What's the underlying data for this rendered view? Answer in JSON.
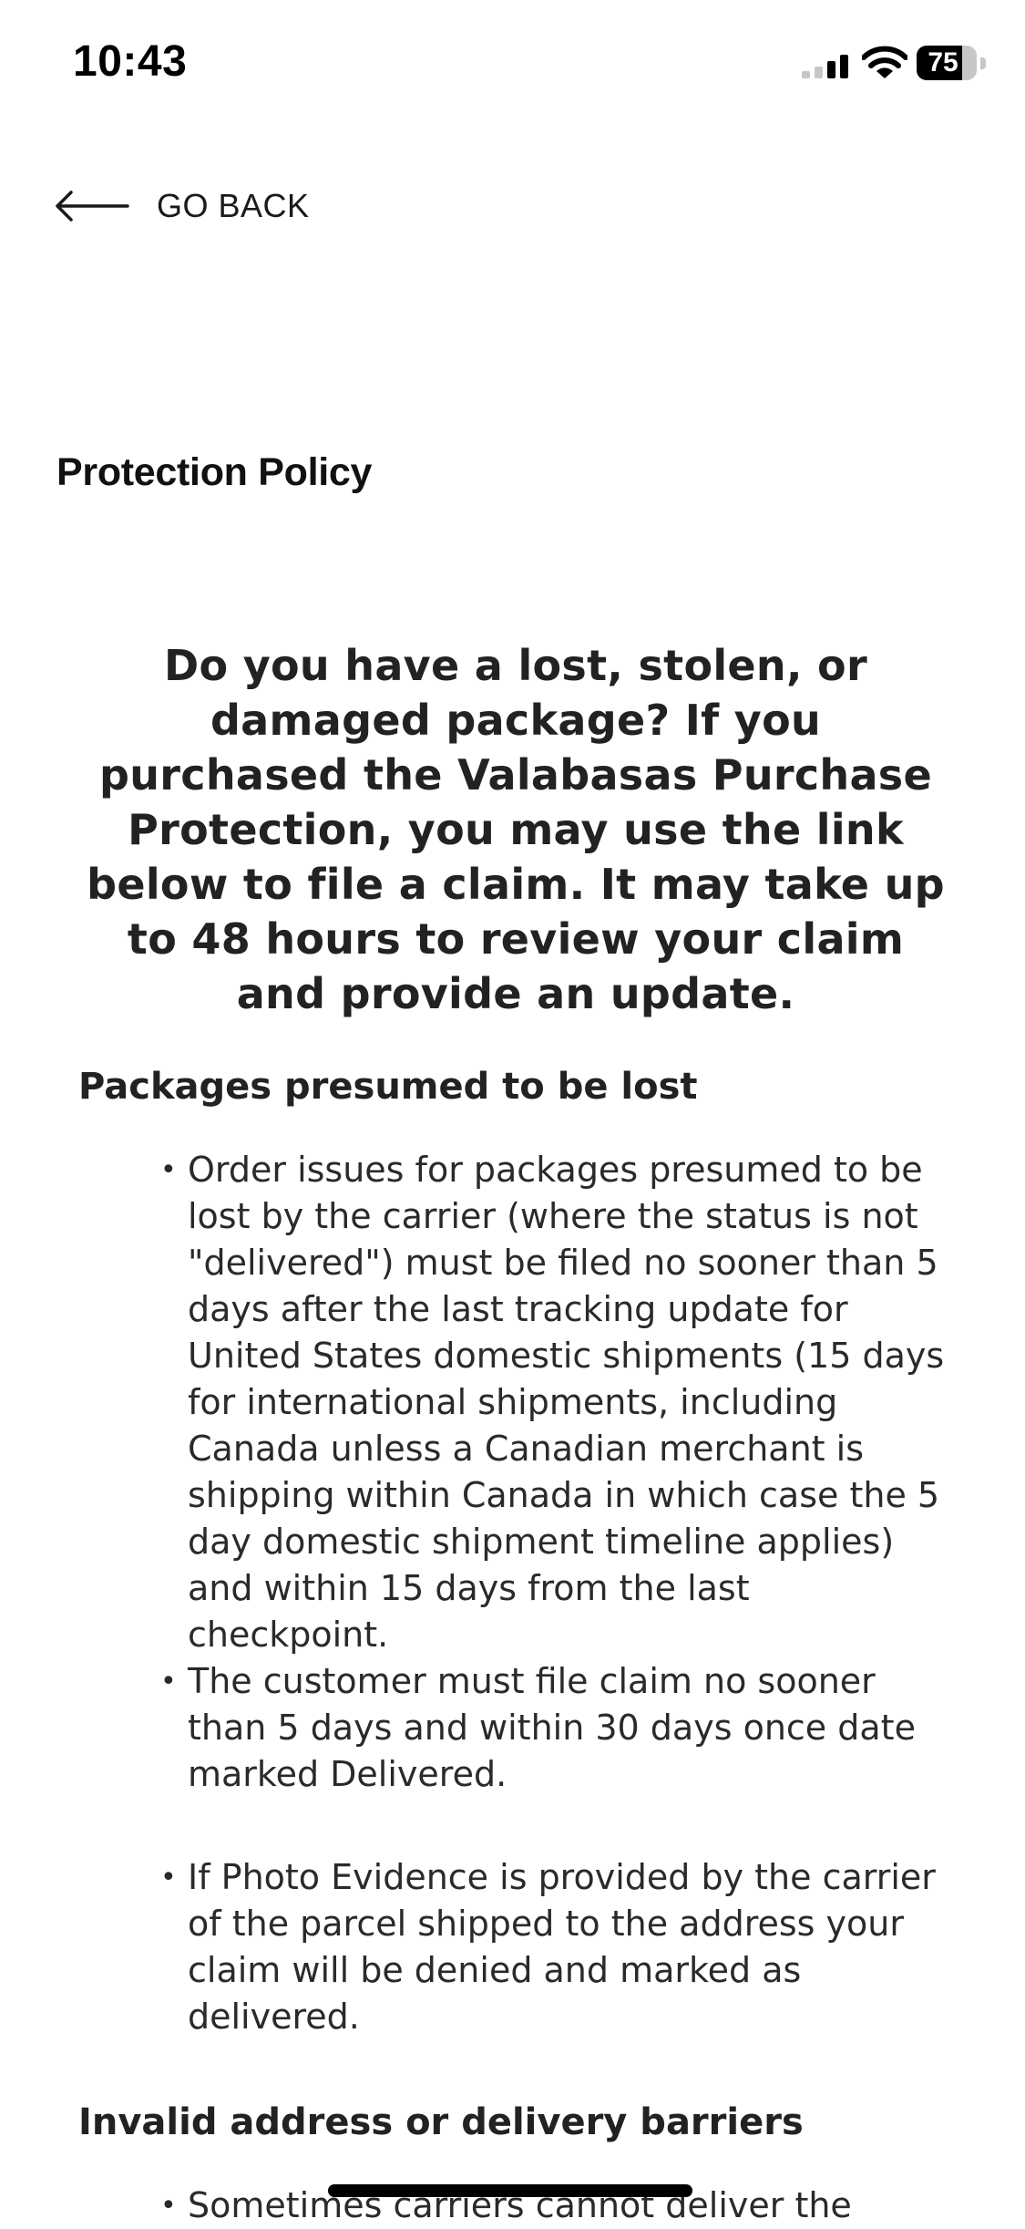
{
  "status_bar": {
    "time": "10:43",
    "battery_level": "75",
    "battery_fraction": 0.75,
    "icons": [
      "signal-icon",
      "wifi-icon",
      "battery-icon"
    ]
  },
  "nav": {
    "back_label": "GO BACK",
    "back_icon": "arrow-left-icon"
  },
  "page": {
    "title": "Protection Policy"
  },
  "intro": {
    "heading": "Do you have a lost, stolen, or damaged package? If you purchased the Valabasas Purchase Protection, you may use the link below to file a claim. It may take up to 48 hours to review your claim and provide an update."
  },
  "sections": [
    {
      "heading": "Packages presumed to be lost",
      "items": [
        "Order issues for packages presumed to be lost by the carrier (where the status is not \"delivered\") must be filed no sooner than 5 days after the last tracking update for United States domestic shipments (15 days for international shipments, including Canada unless a Canadian merchant is shipping within Canada in which case the 5 day domestic shipment timeline applies) and within 15 days from the last checkpoint.",
        "The customer must file claim no sooner than 5 days and within 30 days once date marked Delivered.",
        "If Photo Evidence is provided by the carrier of the parcel shipped to the address your claim will be denied and marked as delivered."
      ]
    },
    {
      "heading": "Invalid address or delivery barriers",
      "items": [
        "Sometimes carriers cannot deliver the"
      ]
    }
  ],
  "colors": {
    "text": "#222222",
    "background": "#ffffff",
    "home_indicator": "#000000"
  }
}
